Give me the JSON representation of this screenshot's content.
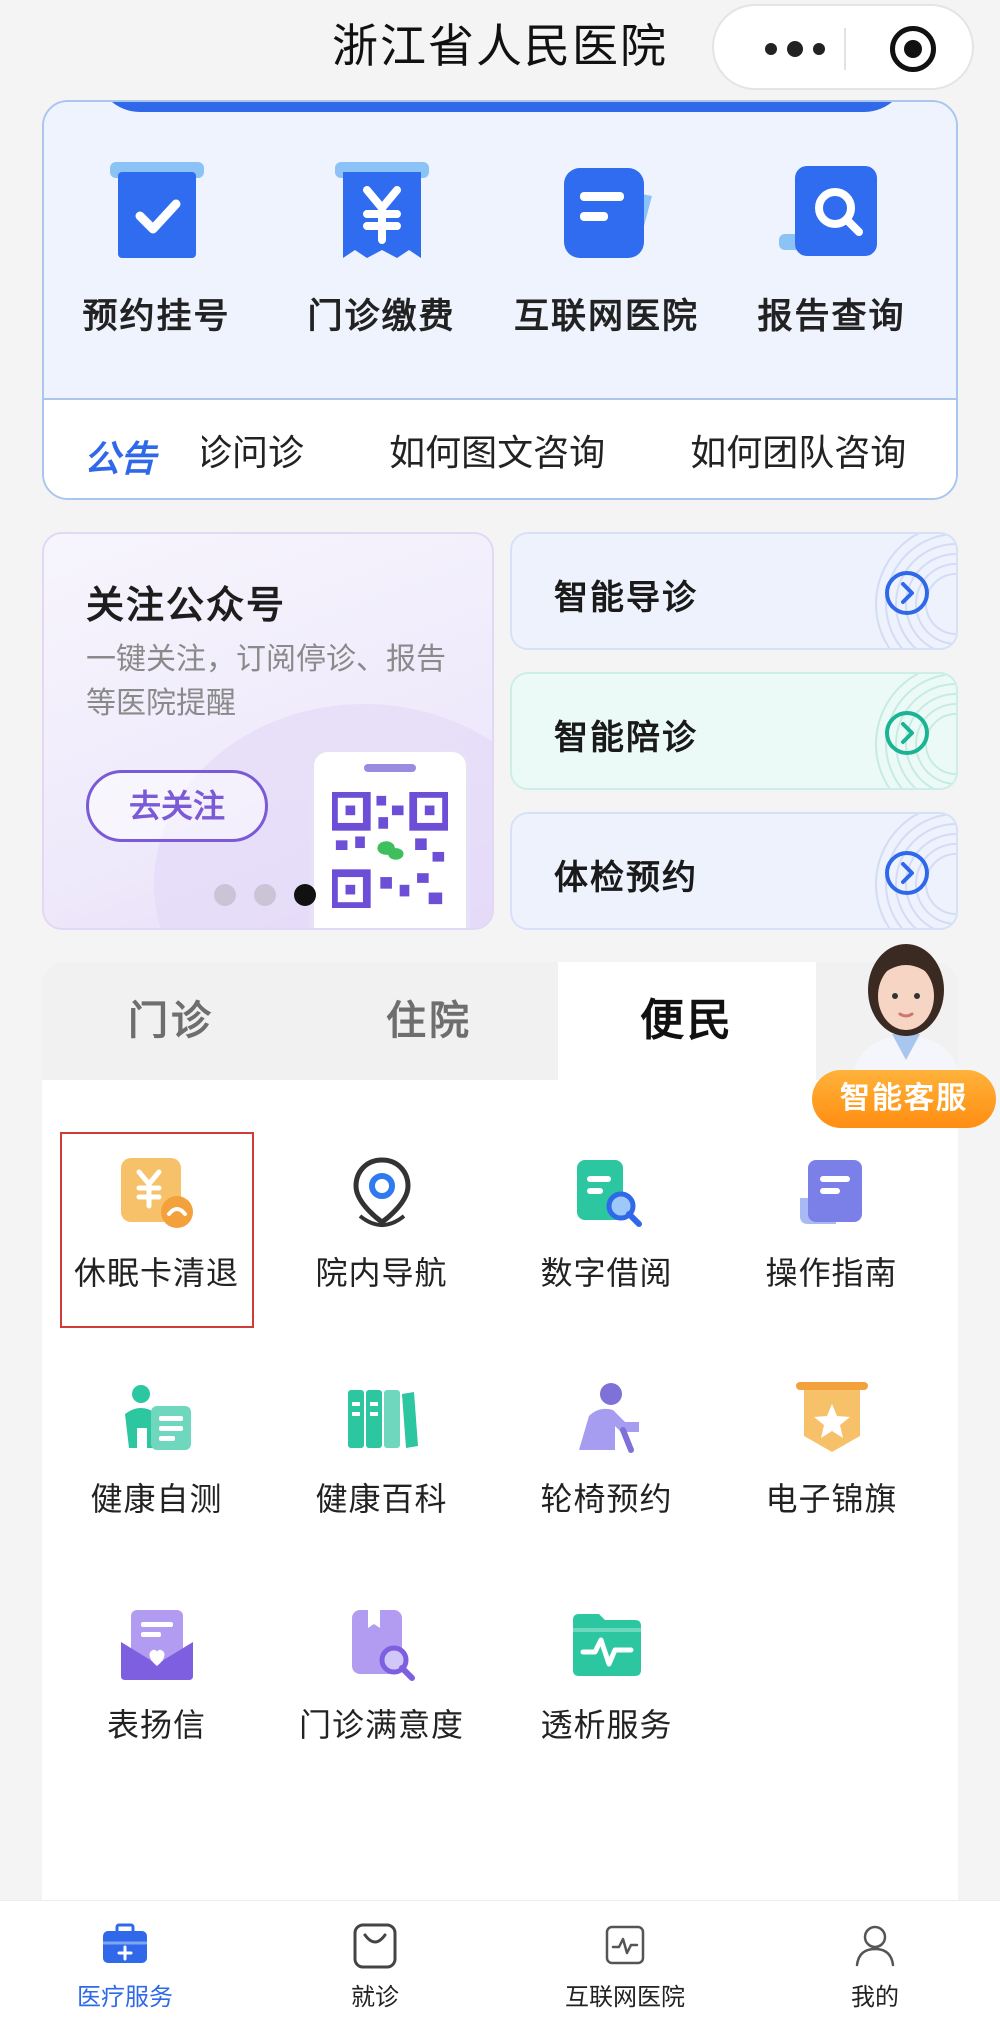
{
  "header": {
    "title": "浙江省人民医院"
  },
  "quick_actions": [
    {
      "label": "预约挂号",
      "icon": "calendar-check-icon"
    },
    {
      "label": "门诊缴费",
      "icon": "yuan-receipt-icon"
    },
    {
      "label": "互联网医院",
      "icon": "chat-document-icon"
    },
    {
      "label": "报告查询",
      "icon": "search-report-icon"
    }
  ],
  "notice": {
    "tag": "公告",
    "items": [
      "复诊问诊",
      "如何图文咨询",
      "如何团队咨询"
    ]
  },
  "promo": {
    "title": "关注公众号",
    "subtitle": "一键关注，订阅停诊、报告等医院提醒",
    "button": "去关注",
    "slide_index": 3,
    "slide_count": 3
  },
  "service_cards": [
    {
      "label": "智能导诊",
      "accent": "#2f68e8"
    },
    {
      "label": "智能陪诊",
      "accent": "#1ab394"
    },
    {
      "label": "体检预约",
      "accent": "#2f68e8"
    }
  ],
  "tabs": {
    "items": [
      "门诊",
      "住院",
      "便民"
    ],
    "active": "便民"
  },
  "grid": [
    {
      "label": "休眠卡清退",
      "icon": "card-refund-icon"
    },
    {
      "label": "院内导航",
      "icon": "location-pin-icon"
    },
    {
      "label": "数字借阅",
      "icon": "document-search-icon"
    },
    {
      "label": "操作指南",
      "icon": "guide-book-icon"
    },
    {
      "label": "健康自测",
      "icon": "person-checklist-icon"
    },
    {
      "label": "健康百科",
      "icon": "books-icon"
    },
    {
      "label": "轮椅预约",
      "icon": "wheelchair-user-icon"
    },
    {
      "label": "电子锦旗",
      "icon": "banner-star-icon"
    },
    {
      "label": "表扬信",
      "icon": "letter-heart-icon"
    },
    {
      "label": "门诊满意度",
      "icon": "survey-search-icon"
    },
    {
      "label": "透析服务",
      "icon": "folder-pulse-icon"
    }
  ],
  "assistant": {
    "label": "智能客服"
  },
  "bottom_nav": [
    {
      "label": "医疗服务",
      "icon": "medical-kit-icon",
      "active": true
    },
    {
      "label": "就诊",
      "icon": "bag-icon",
      "active": false
    },
    {
      "label": "互联网医院",
      "icon": "pulse-monitor-icon",
      "active": false
    },
    {
      "label": "我的",
      "icon": "user-icon",
      "active": false
    }
  ],
  "colors": {
    "primary": "#2f68e8",
    "accent_orange": "#ffa22a",
    "highlight_border": "#d33a3a"
  }
}
